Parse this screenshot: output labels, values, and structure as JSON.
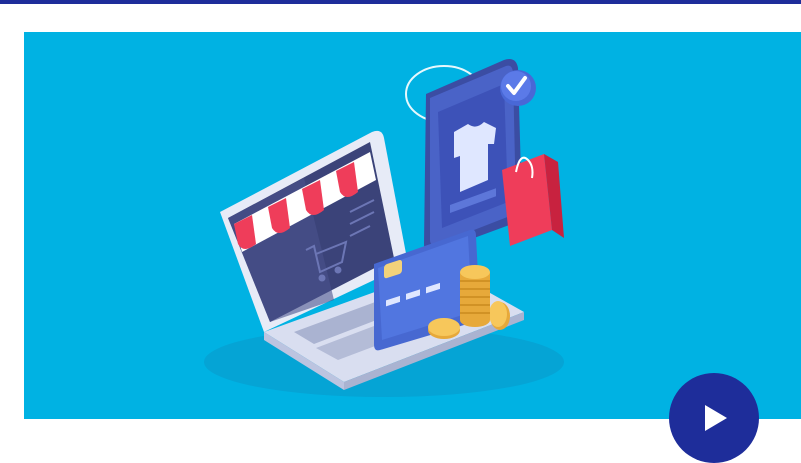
{
  "header": {
    "accent_color": "#1e2d9a"
  },
  "banner": {
    "background_color": "#00b2e3",
    "illustration": "isometric-online-shopping-illustration",
    "objects": [
      "laptop-icon",
      "shop-awning-icon",
      "shopping-cart-icon",
      "smartphone-icon",
      "tshirt-icon",
      "checkmark-badge-icon",
      "shopping-bag-icon",
      "credit-card-icon",
      "coin-stack-icon"
    ]
  },
  "video": {
    "play_icon": "play-icon",
    "button_color": "#1e2d9a"
  }
}
